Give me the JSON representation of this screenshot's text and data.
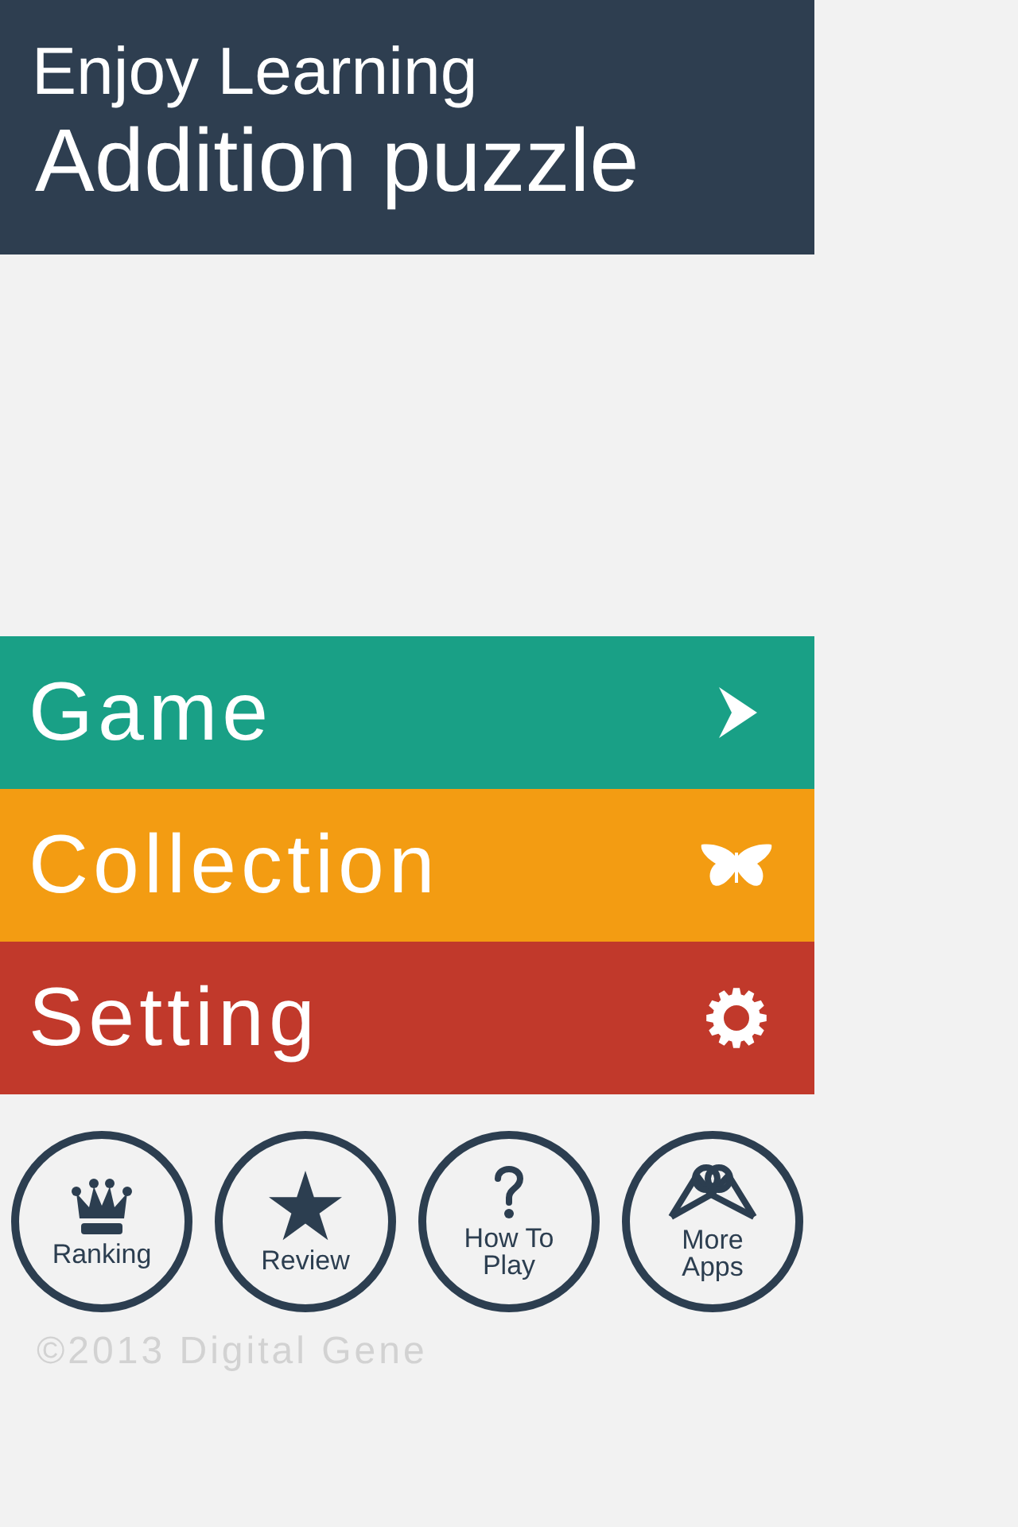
{
  "header": {
    "subtitle": "Enjoy Learning",
    "title": "Addition puzzle"
  },
  "menu": [
    {
      "label": "Game",
      "kind": "arrow",
      "color": "#19a086"
    },
    {
      "label": "Collection",
      "kind": "butterfly",
      "color": "#f39c12"
    },
    {
      "label": "Setting",
      "kind": "gear",
      "color": "#c1392b"
    }
  ],
  "round_buttons": [
    {
      "label": "Ranking",
      "kind": "crown"
    },
    {
      "label": "Review",
      "kind": "star"
    },
    {
      "label": "How To Play",
      "kind": "question"
    },
    {
      "label": "More Apps",
      "kind": "rings"
    }
  ],
  "footer": {
    "copyright": "©2013 Digital Gene"
  }
}
